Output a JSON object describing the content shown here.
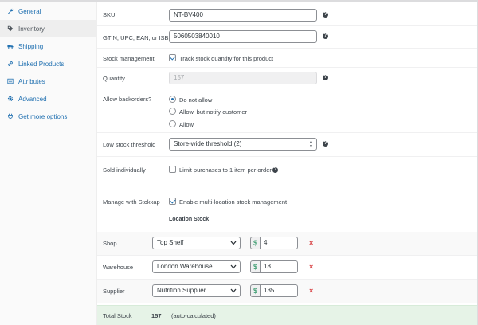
{
  "tabs": [
    {
      "label": "General",
      "icon": "wrench-icon"
    },
    {
      "label": "Inventory",
      "icon": "tag-icon"
    },
    {
      "label": "Shipping",
      "icon": "truck-icon"
    },
    {
      "label": "Linked Products",
      "icon": "link-icon"
    },
    {
      "label": "Attributes",
      "icon": "list-icon"
    },
    {
      "label": "Advanced",
      "icon": "gear-icon"
    },
    {
      "label": "Get more options",
      "icon": "plugin-icon"
    }
  ],
  "active_tab": "Inventory",
  "form": {
    "sku": {
      "label": "SKU",
      "value": "NT-BV400"
    },
    "gtin": {
      "label": "GTIN, UPC, EAN, or ISBN",
      "value": "5060503840010"
    },
    "stock_management": {
      "label": "Stock management",
      "checkbox_label": "Track stock quantity for this product",
      "checked": true
    },
    "quantity": {
      "label": "Quantity",
      "value": "157"
    },
    "backorders": {
      "label": "Allow backorders?",
      "options": [
        "Do not allow",
        "Allow, but notify customer",
        "Allow"
      ],
      "selected": "Do not allow"
    },
    "low_stock": {
      "label": "Low stock threshold",
      "value": "Store-wide threshold (2)"
    },
    "sold_individually": {
      "label": "Sold individually",
      "checkbox_label": "Limit purchases to 1 item per order",
      "checked": false
    },
    "stokkap": {
      "label": "Manage with Stokkap",
      "checkbox_label": "Enable multi-location stock management",
      "checked": true
    },
    "location_stock_heading": "Location Stock"
  },
  "locations": [
    {
      "label": "Shop",
      "location": "Top Shelf",
      "qty": "4"
    },
    {
      "label": "Warehouse",
      "location": "London Warehouse",
      "qty": "18"
    },
    {
      "label": "Supplier",
      "location": "Nutrition Supplier",
      "qty": "135"
    }
  ],
  "currency_symbol": "$",
  "delete_symbol": "×",
  "help_symbol": "?",
  "total": {
    "label": "Total Stock",
    "value": "157",
    "note": "(auto-calculated)"
  },
  "colors": {
    "link": "#2271b1",
    "delete": "#d63638",
    "total_bg": "#e6f3e7",
    "money": "#4aa37a"
  }
}
